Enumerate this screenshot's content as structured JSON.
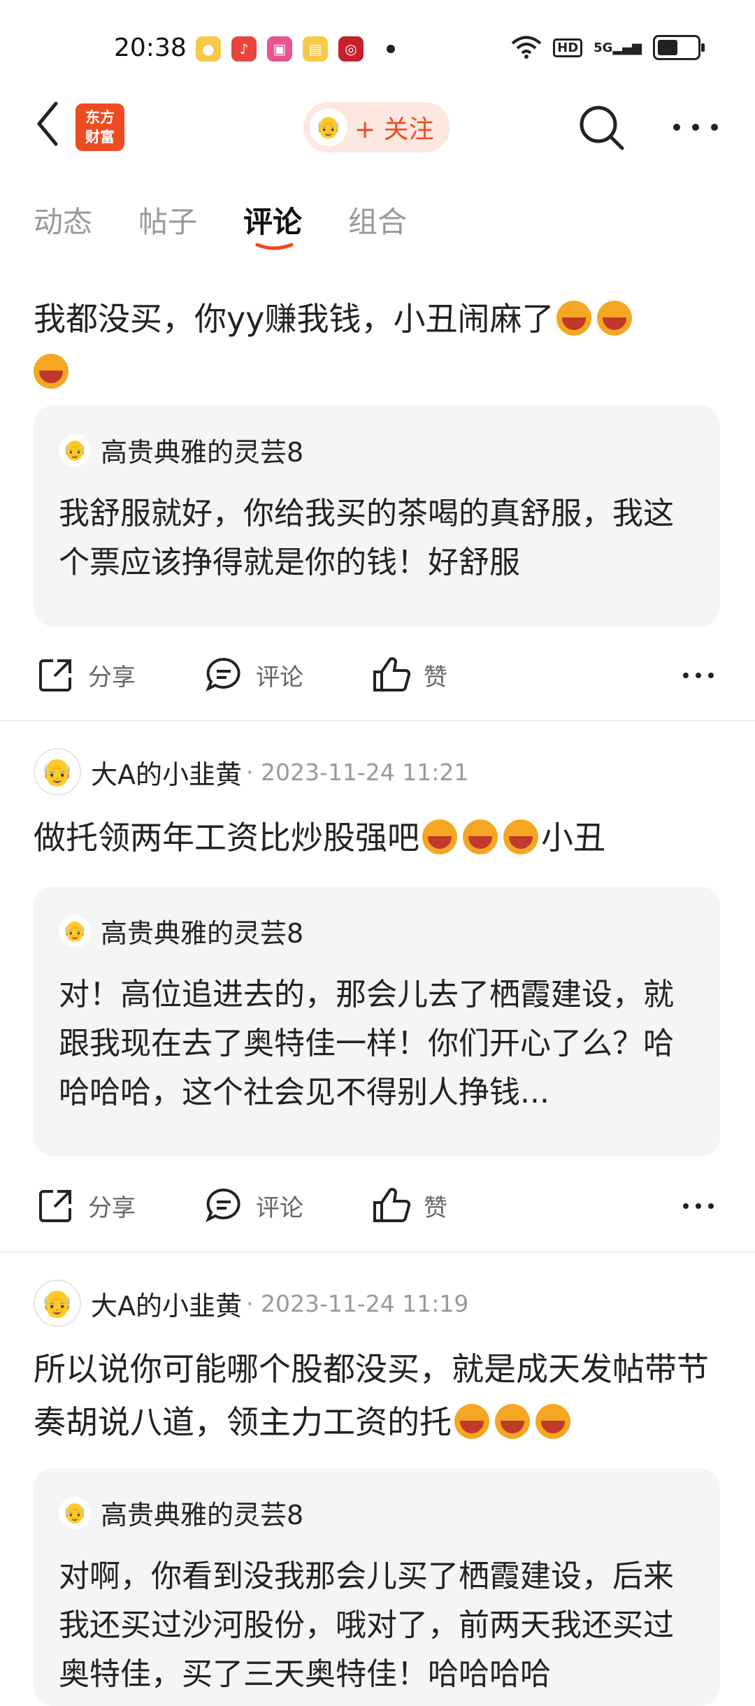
{
  "status_bar": {
    "time": "20:38",
    "app_icons": [
      "weibo-icon",
      "douyin-icon",
      "bilibili-icon",
      "books-icon",
      "bank-icon"
    ],
    "network": "5G",
    "hd": "HD"
  },
  "nav": {
    "logo_line1": "东方",
    "logo_line2": "财富",
    "follow_label": "+ 关注"
  },
  "tabs": [
    {
      "label": "动态"
    },
    {
      "label": "帖子"
    },
    {
      "label": "评论",
      "active": true
    },
    {
      "label": "组合"
    }
  ],
  "posts": [
    {
      "author": "",
      "date": "",
      "text_before": "我都没买，你yy赚我钱，小丑闹麻了",
      "emoji_count_line1": 2,
      "reply": {
        "author": "高贵典雅的灵芸8",
        "text": "我舒服就好，你给我买的茶喝的真舒服，我这个票应该挣得就是你的钱！好舒服"
      }
    },
    {
      "author": "大A的小韭黄",
      "date": "· 2023-11-24 11:21",
      "text_before": "做托领两年工资比炒股强吧",
      "text_after": "小丑",
      "reply": {
        "author": "高贵典雅的灵芸8",
        "text": "对！高位追进去的，那会儿去了栖霞建设，就跟我现在去了奥特佳一样！你们开心了么？哈哈哈哈，这个社会见不得别人挣钱..."
      }
    },
    {
      "author": "大A的小韭黄",
      "date": "· 2023-11-24 11:19",
      "text_before": "所以说你可能哪个股都没买，就是成天发帖带节奏胡说八道，领主力工资的托",
      "reply": {
        "author": "高贵典雅的灵芸8",
        "text": "对啊，你看到没我那会儿买了栖霞建设，后来我还买过沙河股份，哦对了，前两天我还买过奥特佳，买了三天奥特佳！哈哈哈哈"
      }
    }
  ],
  "actions": {
    "share": "分享",
    "comment": "评论",
    "like": "赞"
  },
  "colors": {
    "brand": "#ef4b22",
    "follow_bg": "#fde8e1",
    "reply_bg": "#f5f5f7"
  }
}
